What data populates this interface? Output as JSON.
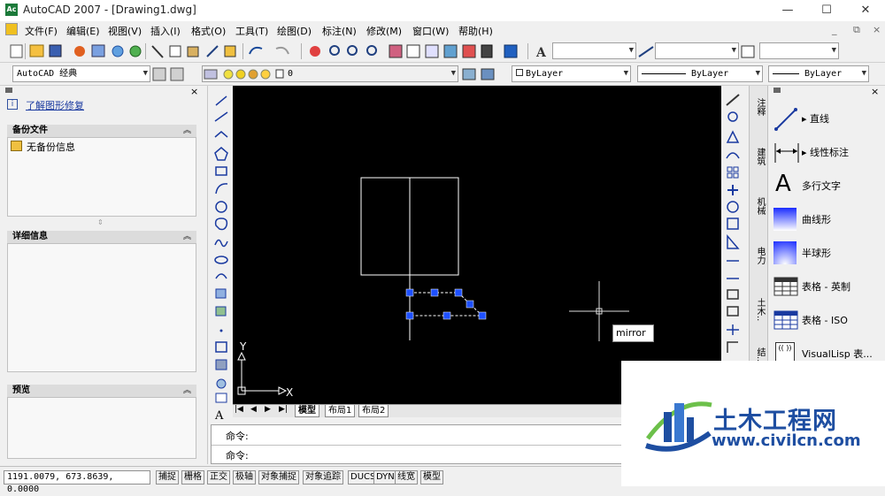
{
  "window": {
    "title": "AutoCAD 2007 - [Drawing1.dwg]",
    "minimize": "—",
    "maximize": "☐",
    "close": "✕"
  },
  "menu": [
    "文件(F)",
    "编辑(E)",
    "视图(V)",
    "插入(I)",
    "格式(O)",
    "工具(T)",
    "绘图(D)",
    "标注(N)",
    "修改(M)",
    "窗口(W)",
    "帮助(H)"
  ],
  "toolbar2": {
    "workspace": "AutoCAD 经典",
    "layer": "0",
    "color": "ByLayer",
    "linetype": "ByLayer",
    "lineweight": "ByLayer"
  },
  "leftpanel": {
    "link": "了解图形修复",
    "backup": {
      "title": "备份文件",
      "item": "无备份信息"
    },
    "details": {
      "title": "详细信息"
    },
    "preview": {
      "title": "预览"
    }
  },
  "canvas": {
    "axis_x": "X",
    "axis_y": "Y",
    "tooltip": "mirror"
  },
  "tabs": [
    "模型",
    "布局1",
    "布局2"
  ],
  "command": {
    "line1": "命令:",
    "line2": "命令:"
  },
  "right_tabs": [
    "注释",
    "建筑",
    "机械",
    "电力",
    "土木..",
    "结..."
  ],
  "palette": [
    "直线",
    "线性标注",
    "多行文字",
    "曲线形",
    "半球形",
    "表格 - 英制",
    "表格 - ISO",
    "VisualLisp 表..."
  ],
  "status": {
    "coords": "1191.0079, 673.8639, 0.0000",
    "buttons": [
      "捕捉",
      "栅格",
      "正交",
      "极轴",
      "对象捕捉",
      "对象追踪",
      "DUCS",
      "DYN",
      "线宽",
      "模型"
    ]
  },
  "watermark": {
    "name": "土木工程网",
    "url": "www.civilcn.com"
  },
  "colors": {
    "canvas": "#000000",
    "grip": "#1e50ff",
    "brand": "#1e4ea1"
  }
}
